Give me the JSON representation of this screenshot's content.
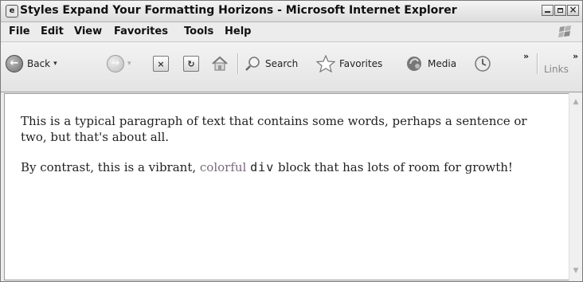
{
  "window": {
    "title": "Styles Expand Your Formatting Horizons - Microsoft Internet Explorer",
    "app_icon": "ie-page-icon",
    "controls": {
      "minimize": "minimize-icon",
      "maximize": "maximize-icon",
      "close": "close-icon",
      "close_glyph": "×"
    }
  },
  "menu": {
    "items": [
      "File",
      "Edit",
      "View",
      "Favorites",
      "Tools",
      "Help"
    ]
  },
  "toolbar": {
    "back_label": "Back",
    "back_icon": "back-arrow-icon",
    "forward_icon": "forward-arrow-icon",
    "back_glyph": "←",
    "forward_glyph": "→",
    "stop_glyph": "×",
    "refresh_glyph": "↻",
    "dropdown_glyph": "▾",
    "overflow_glyph": "»",
    "stop_icon": "stop-icon",
    "refresh_icon": "refresh-icon",
    "home_icon": "home-icon",
    "search_label": "Search",
    "search_icon": "search-icon",
    "favorites_label": "Favorites",
    "favorites_icon": "star-icon",
    "media_label": "Media",
    "media_icon": "media-icon",
    "history_icon": "history-icon",
    "links_label": "Links"
  },
  "page": {
    "paragraph": "This is a typical paragraph of text that contains some words, perhaps a sentence or two, but that's about all.",
    "div_prefix": "By contrast, this is a vibrant, ",
    "div_colorful": "colorful",
    "div_code": "div",
    "div_suffix": " block that has lots of room for growth!"
  },
  "scrollbar": {
    "up_glyph": "▲",
    "down_glyph": "▼"
  }
}
